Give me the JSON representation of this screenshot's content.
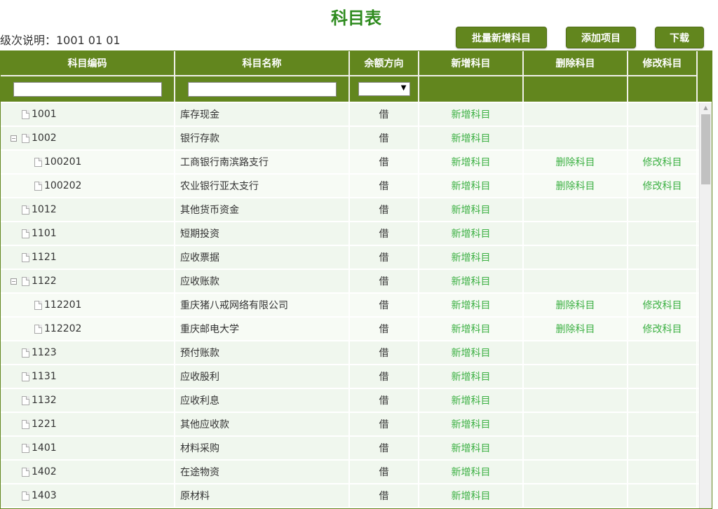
{
  "title": "科目表",
  "level_desc": "级次说明：1001 01 01",
  "toolbar": {
    "batch_add": "批量新增科目",
    "add_project": "添加项目",
    "download": "下载"
  },
  "columns": [
    "科目编码",
    "科目名称",
    "余额方向",
    "新增科目",
    "删除科目",
    "修改科目"
  ],
  "filter": {
    "code_value": "",
    "name_value": "",
    "direction_value": ""
  },
  "actions": {
    "add": "新增科目",
    "delete": "删除科目",
    "modify": "修改科目"
  },
  "rows": [
    {
      "code": "1001",
      "name": "库存现金",
      "dir": "借",
      "level": 1,
      "expandable": false,
      "child": false
    },
    {
      "code": "1002",
      "name": "银行存款",
      "dir": "借",
      "level": 1,
      "expandable": true,
      "child": false
    },
    {
      "code": "100201",
      "name": "工商银行南滨路支行",
      "dir": "借",
      "level": 2,
      "expandable": false,
      "child": true
    },
    {
      "code": "100202",
      "name": "农业银行亚太支行",
      "dir": "借",
      "level": 2,
      "expandable": false,
      "child": true
    },
    {
      "code": "1012",
      "name": "其他货币资金",
      "dir": "借",
      "level": 1,
      "expandable": false,
      "child": false
    },
    {
      "code": "1101",
      "name": "短期投资",
      "dir": "借",
      "level": 1,
      "expandable": false,
      "child": false
    },
    {
      "code": "1121",
      "name": "应收票据",
      "dir": "借",
      "level": 1,
      "expandable": false,
      "child": false
    },
    {
      "code": "1122",
      "name": "应收账款",
      "dir": "借",
      "level": 1,
      "expandable": true,
      "child": false
    },
    {
      "code": "112201",
      "name": "重庆猪八戒网络有限公司",
      "dir": "借",
      "level": 2,
      "expandable": false,
      "child": true
    },
    {
      "code": "112202",
      "name": "重庆邮电大学",
      "dir": "借",
      "level": 2,
      "expandable": false,
      "child": true
    },
    {
      "code": "1123",
      "name": "预付账款",
      "dir": "借",
      "level": 1,
      "expandable": false,
      "child": false
    },
    {
      "code": "1131",
      "name": "应收股利",
      "dir": "借",
      "level": 1,
      "expandable": false,
      "child": false
    },
    {
      "code": "1132",
      "name": "应收利息",
      "dir": "借",
      "level": 1,
      "expandable": false,
      "child": false
    },
    {
      "code": "1221",
      "name": "其他应收款",
      "dir": "借",
      "level": 1,
      "expandable": false,
      "child": false
    },
    {
      "code": "1401",
      "name": "材料采购",
      "dir": "借",
      "level": 1,
      "expandable": false,
      "child": false
    },
    {
      "code": "1402",
      "name": "在途物资",
      "dir": "借",
      "level": 1,
      "expandable": false,
      "child": false
    },
    {
      "code": "1403",
      "name": "原材料",
      "dir": "借",
      "level": 1,
      "expandable": false,
      "child": false
    }
  ]
}
